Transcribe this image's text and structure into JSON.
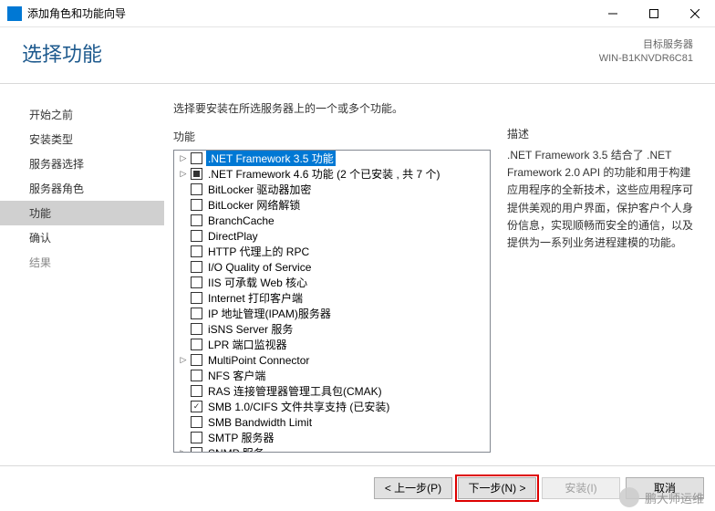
{
  "titlebar": {
    "text": "添加角色和功能向导"
  },
  "header": {
    "title": "选择功能",
    "target_label": "目标服务器",
    "target_value": "WIN-B1KNVDR6C81"
  },
  "sidebar": {
    "items": [
      {
        "label": "开始之前",
        "state": "enabled"
      },
      {
        "label": "安装类型",
        "state": "enabled"
      },
      {
        "label": "服务器选择",
        "state": "enabled"
      },
      {
        "label": "服务器角色",
        "state": "enabled"
      },
      {
        "label": "功能",
        "state": "active"
      },
      {
        "label": "确认",
        "state": "enabled"
      },
      {
        "label": "结果",
        "state": "disabled"
      }
    ]
  },
  "main": {
    "prompt": "选择要安装在所选服务器上的一个或多个功能。",
    "features_label": "功能",
    "desc_label": "描述",
    "description": ".NET Framework 3.5 结合了 .NET Framework 2.0 API 的功能和用于构建应用程序的全新技术，这些应用程序可提供美观的用户界面，保护客户个人身份信息，实现顺畅而安全的通信，以及提供为一系列业务进程建模的功能。",
    "features": [
      {
        "expand": "▷",
        "check": "none",
        "label": ".NET Framework 3.5 功能",
        "selected": true
      },
      {
        "expand": "▷",
        "check": "partial",
        "label": ".NET Framework 4.6 功能 (2 个已安装 , 共 7 个)"
      },
      {
        "expand": "",
        "check": "none",
        "label": "BitLocker 驱动器加密"
      },
      {
        "expand": "",
        "check": "none",
        "label": "BitLocker 网络解锁"
      },
      {
        "expand": "",
        "check": "none",
        "label": "BranchCache"
      },
      {
        "expand": "",
        "check": "none",
        "label": "DirectPlay"
      },
      {
        "expand": "",
        "check": "none",
        "label": "HTTP 代理上的 RPC"
      },
      {
        "expand": "",
        "check": "none",
        "label": "I/O Quality of Service"
      },
      {
        "expand": "",
        "check": "none",
        "label": "IIS 可承载 Web 核心"
      },
      {
        "expand": "",
        "check": "none",
        "label": "Internet 打印客户端"
      },
      {
        "expand": "",
        "check": "none",
        "label": "IP 地址管理(IPAM)服务器"
      },
      {
        "expand": "",
        "check": "none",
        "label": "iSNS Server 服务"
      },
      {
        "expand": "",
        "check": "none",
        "label": "LPR 端口监视器"
      },
      {
        "expand": "▷",
        "check": "none",
        "label": "MultiPoint Connector"
      },
      {
        "expand": "",
        "check": "none",
        "label": "NFS 客户端"
      },
      {
        "expand": "",
        "check": "none",
        "label": "RAS 连接管理器管理工具包(CMAK)"
      },
      {
        "expand": "",
        "check": "checked",
        "label": "SMB 1.0/CIFS 文件共享支持 (已安装)"
      },
      {
        "expand": "",
        "check": "none",
        "label": "SMB Bandwidth Limit"
      },
      {
        "expand": "",
        "check": "none",
        "label": "SMTP 服务器"
      },
      {
        "expand": "▷",
        "check": "none",
        "label": "SNMP 服务"
      }
    ]
  },
  "footer": {
    "prev": "< 上一步(P)",
    "next": "下一步(N) >",
    "install": "安装(I)",
    "cancel": "取消"
  },
  "watermark": "鹏大师运维"
}
